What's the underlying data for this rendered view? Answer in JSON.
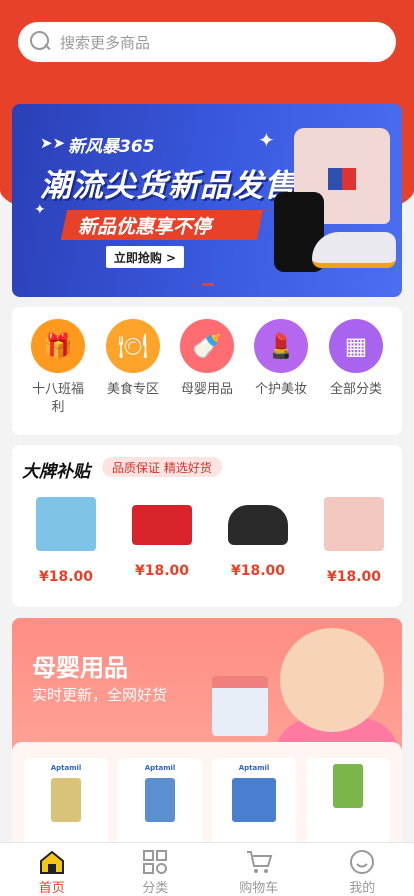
{
  "search": {
    "placeholder": "搜索更多商品"
  },
  "banner": {
    "brand": "新风暴365",
    "headline": "潮流尖货新品发售",
    "tagline": "新品优惠享不停",
    "button": "立即抢购 >"
  },
  "categories": [
    {
      "label": "十八班福利",
      "icon": "gift-icon",
      "color": "#ff9a1e"
    },
    {
      "label": "美食专区",
      "icon": "food-cloche-icon",
      "color": "#ffa42a"
    },
    {
      "label": "母婴用品",
      "icon": "baby-bottle-icon",
      "color": "#ff6d73"
    },
    {
      "label": "个护美妆",
      "icon": "cosmetics-icon",
      "color": "#b468f0"
    },
    {
      "label": "全部分类",
      "icon": "grid-icon",
      "color": "#a964ef"
    }
  ],
  "brand_section": {
    "title": "大牌补贴",
    "subtitle": "品质保证 精选好货",
    "items": [
      {
        "price": "¥18.00",
        "img_color": "#7fc4e6"
      },
      {
        "price": "¥18.00",
        "img_color": "#d8232a"
      },
      {
        "price": "¥18.00",
        "img_color": "#2a2a2a"
      },
      {
        "price": "¥18.00",
        "img_color": "#f3c8c0"
      }
    ]
  },
  "mom_section": {
    "title": "母婴用品",
    "subtitle": "实时更新，全网好货",
    "items": [
      {
        "logo": "Aptamil",
        "can_color": "#d9c27a"
      },
      {
        "logo": "Aptamil",
        "can_color": "#5c8fd0"
      },
      {
        "logo": "Aptamil",
        "can_color": "#4a7fd0"
      },
      {
        "logo": "",
        "can_color": "#7ab64a"
      }
    ]
  },
  "tabbar": {
    "tabs": [
      {
        "label": "首页",
        "icon": "home-icon",
        "active": true
      },
      {
        "label": "分类",
        "icon": "category-icon",
        "active": false
      },
      {
        "label": "购物车",
        "icon": "cart-icon",
        "active": false
      },
      {
        "label": "我的",
        "icon": "profile-icon",
        "active": false
      }
    ]
  },
  "colors": {
    "primary": "#e8412a"
  }
}
